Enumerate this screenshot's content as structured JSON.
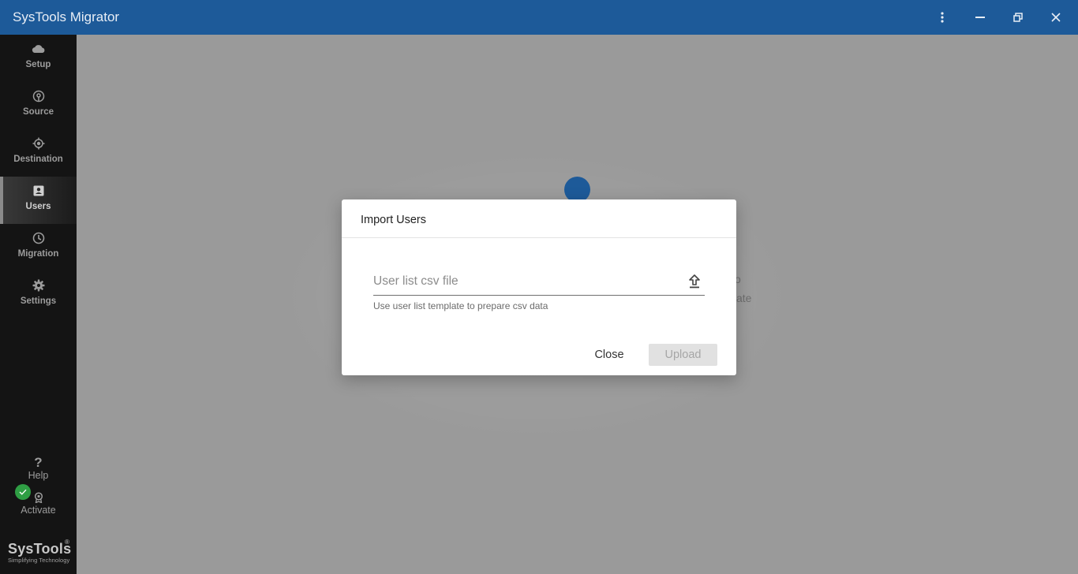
{
  "app": {
    "title": "SysTools Migrator"
  },
  "window_controls": [
    {
      "name": "kebab-menu-icon"
    },
    {
      "name": "minimize-icon"
    },
    {
      "name": "restore-icon"
    },
    {
      "name": "close-icon"
    }
  ],
  "sidebar": {
    "items": [
      {
        "label": "Setup",
        "icon": "cloud-icon"
      },
      {
        "label": "Source",
        "icon": "source-icon"
      },
      {
        "label": "Destination",
        "icon": "target-icon"
      },
      {
        "label": "Users",
        "icon": "user-card-icon",
        "active": true
      },
      {
        "label": "Migration",
        "icon": "clock-icon"
      },
      {
        "label": "Settings",
        "icon": "gear-icon"
      }
    ],
    "help": {
      "symbol": "?",
      "label": "Help"
    },
    "activate": {
      "label": "Activate"
    },
    "brand": {
      "name": "SysTools",
      "registered": "®",
      "tagline": "Simplifying Technology"
    }
  },
  "background": {
    "partial_text_1": "o",
    "partial_text_2": "ate"
  },
  "dialog": {
    "title": "Import Users",
    "file_field": {
      "placeholder": "User list csv file"
    },
    "hint": "Use user list template to prepare csv data",
    "buttons": {
      "close": "Close",
      "upload": "Upload"
    }
  },
  "colors": {
    "titlebar": "#1d5a99",
    "sidebar": "#141414",
    "overlay": "#9a9a9a",
    "accent": "#1d5a99",
    "success": "#2f9e44"
  }
}
